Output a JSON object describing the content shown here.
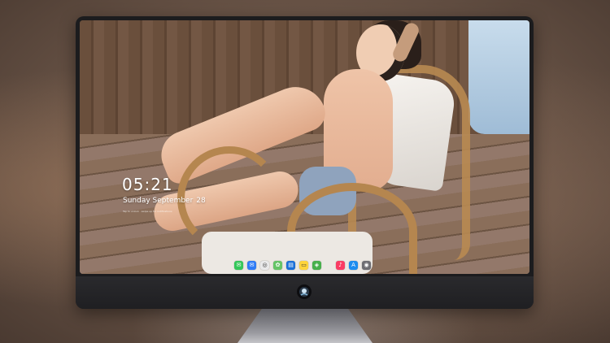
{
  "lock_screen": {
    "time": "05:21",
    "date_weekday_month": "Sunday September",
    "date_day": "28",
    "subtext": "Tap to unlock · swipe up for notifications"
  },
  "dock": {
    "icons": [
      {
        "name": "messages-icon",
        "color": "#34c759",
        "glyph": "✉"
      },
      {
        "name": "mail-icon",
        "color": "#2f7cf6",
        "glyph": "✉"
      },
      {
        "name": "safari-icon",
        "color": "#e9e9ea",
        "glyph": "◎"
      },
      {
        "name": "photos-icon",
        "color": "#65c466",
        "glyph": "✿"
      },
      {
        "name": "film-icon",
        "color": "#1a6fd8",
        "glyph": "▤"
      },
      {
        "name": "notes-icon",
        "color": "#ffd43b",
        "glyph": "▭"
      },
      {
        "name": "maps-icon",
        "color": "#47b04b",
        "glyph": "◈"
      },
      {
        "name": "music-icon",
        "color": "#fa3c64",
        "glyph": "♪"
      },
      {
        "name": "appstore-icon",
        "color": "#1c8cf0",
        "glyph": "A"
      },
      {
        "name": "camera-icon",
        "color": "#6e6e73",
        "glyph": "◉"
      }
    ]
  },
  "colors": {
    "bezel": "#1c1c1e",
    "chin": "#2a2a2d",
    "clock_text": "#ffffff"
  }
}
